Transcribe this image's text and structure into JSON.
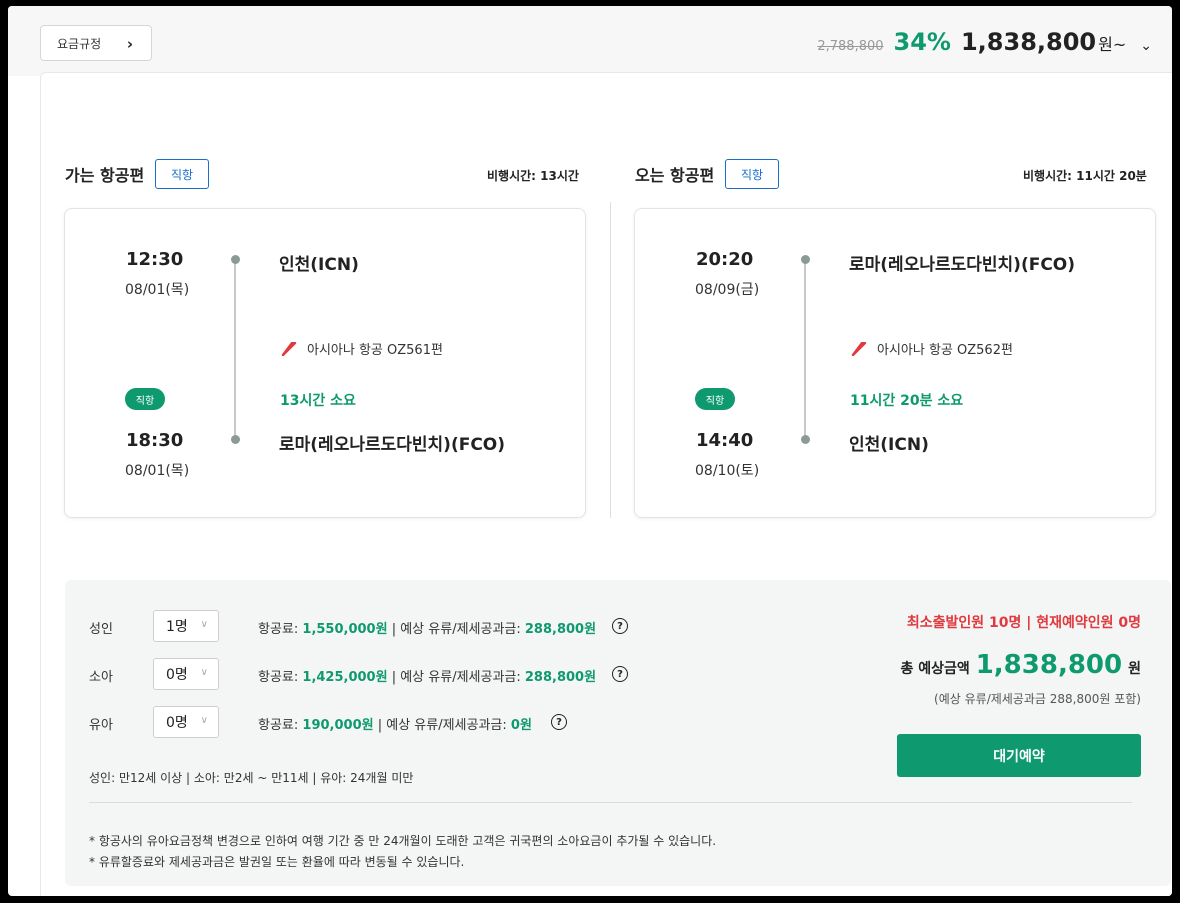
{
  "header": {
    "fare_rules_label": "요금규정",
    "original_price": "2,788,800",
    "discount": "34%",
    "final_price": "1,838,800",
    "final_unit": "원~"
  },
  "outbound": {
    "title": "가는 항공편",
    "badge": "직항",
    "flight_time_label": "비행시간: 13시간",
    "depart_time": "12:30",
    "depart_date": "08/01(목)",
    "depart_city": "인천(ICN)",
    "airline": "아시아나 항공 OZ561편",
    "direct_pill": "직항",
    "duration": "13시간 소요",
    "arrive_time": "18:30",
    "arrive_date": "08/01(목)",
    "arrive_city": "로마(레오나르도다빈치)(FCO)"
  },
  "inbound": {
    "title": "오는 항공편",
    "badge": "직항",
    "flight_time_label": "비행시간: 11시간 20분",
    "depart_time": "20:20",
    "depart_date": "08/09(금)",
    "depart_city": "로마(레오나르도다빈치)(FCO)",
    "airline": "아시아나 항공 OZ562편",
    "direct_pill": "직항",
    "duration": "11시간 20분 소요",
    "arrive_time": "14:40",
    "arrive_date": "08/10(토)",
    "arrive_city": "인천(ICN)"
  },
  "passengers": [
    {
      "label": "성인",
      "count": "1명",
      "fare_label": "항공료:",
      "fare": "1,550,000원",
      "sep": "| 예상 유류/제세공과금:",
      "tax": "288,800원"
    },
    {
      "label": "소아",
      "count": "0명",
      "fare_label": "항공료:",
      "fare": "1,425,000원",
      "sep": "| 예상 유류/제세공과금:",
      "tax": "288,800원"
    },
    {
      "label": "유아",
      "count": "0명",
      "fare_label": "항공료:",
      "fare": "190,000원",
      "sep": "| 예상 유류/제세공과금:",
      "tax": "0원"
    }
  ],
  "help_symbol": "?",
  "age_note": "성인: 만12세 이상 | 소아: 만2세 ~ 만11세 | 유아: 24개월 미만",
  "notes": [
    "* 항공사의 유아요금정책 변경으로 인하여 여행 기간 중 만 24개월이 도래한 고객은 귀국편의 소아요금이 추가될 수 있습니다.",
    "* 유류할증료와 제세공과금은 발권일 또는 환율에 따라 변동될 수 있습니다."
  ],
  "summary": {
    "min_pax": "최소출발인원 10명 | 현재예약인원 0명",
    "total_label": "총 예상금액",
    "total_amount": "1,838,800",
    "total_unit": "원",
    "included": "(예상 유류/제세공과금 288,800원 포함)",
    "wait_button": "대기예약"
  },
  "colors": {
    "accent": "#0e9a6e",
    "alert": "#e0393e",
    "link": "#1a6fc9",
    "airline_logo": "#e0393e"
  }
}
